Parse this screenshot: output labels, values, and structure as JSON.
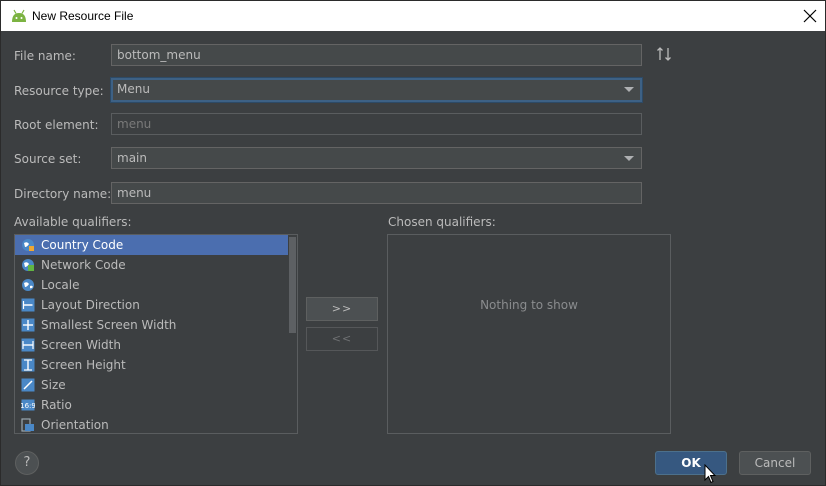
{
  "window": {
    "title": "New Resource File"
  },
  "form": {
    "file_name": {
      "label": "File name:",
      "value": "bottom_menu"
    },
    "resource_type": {
      "label": "Resource type:",
      "value": "Menu"
    },
    "root_element": {
      "label": "Root element:",
      "placeholder": "menu"
    },
    "source_set": {
      "label": "Source set:",
      "value": "main"
    },
    "directory_name": {
      "label": "Directory name:",
      "value": "menu"
    }
  },
  "available_qualifiers": {
    "title": "Available qualifiers:",
    "items": [
      {
        "label": "Country Code",
        "icon": "country-code-icon",
        "selected": true
      },
      {
        "label": "Network Code",
        "icon": "network-code-icon"
      },
      {
        "label": "Locale",
        "icon": "globe-icon"
      },
      {
        "label": "Layout Direction",
        "icon": "layout-direction-icon"
      },
      {
        "label": "Smallest Screen Width",
        "icon": "smallest-width-icon"
      },
      {
        "label": "Screen Width",
        "icon": "screen-width-icon"
      },
      {
        "label": "Screen Height",
        "icon": "screen-height-icon"
      },
      {
        "label": "Size",
        "icon": "size-icon"
      },
      {
        "label": "Ratio",
        "icon": "ratio-icon"
      },
      {
        "label": "Orientation",
        "icon": "orientation-icon"
      }
    ]
  },
  "chosen_qualifiers": {
    "title": "Chosen qualifiers:",
    "empty_text": "Nothing to show"
  },
  "buttons": {
    "add": ">>",
    "remove": "<<",
    "help": "?",
    "ok": "OK",
    "cancel": "Cancel"
  },
  "colors": {
    "background": "#3c3f41",
    "selection": "#4b6eaf",
    "primary_button": "#365880",
    "focus_border": "#3d6185"
  }
}
